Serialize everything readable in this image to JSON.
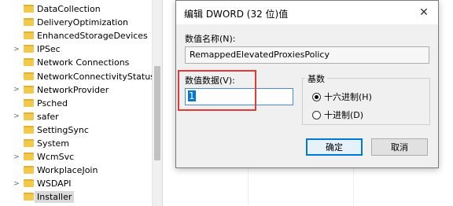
{
  "tree": {
    "items": [
      {
        "label": "DataCollection",
        "expander": ""
      },
      {
        "label": "DeliveryOptimization",
        "expander": ""
      },
      {
        "label": "EnhancedStorageDevices",
        "expander": ""
      },
      {
        "label": "IPSec",
        "expander": ">"
      },
      {
        "label": "Network Connections",
        "expander": ""
      },
      {
        "label": "NetworkConnectivityStatusInc",
        "expander": ""
      },
      {
        "label": "NetworkProvider",
        "expander": ">"
      },
      {
        "label": "Psched",
        "expander": ""
      },
      {
        "label": "safer",
        "expander": ">"
      },
      {
        "label": "SettingSync",
        "expander": ""
      },
      {
        "label": "System",
        "expander": ""
      },
      {
        "label": "WcmSvc",
        "expander": ">"
      },
      {
        "label": "WorkplaceJoin",
        "expander": ""
      },
      {
        "label": "WSDAPI",
        "expander": ">"
      },
      {
        "label": "Installer",
        "expander": "",
        "selected": true
      }
    ]
  },
  "dialog": {
    "title": "编辑 DWORD (32 位)值",
    "close_glyph": "✕",
    "value_name_label": "数值名称(N):",
    "value_name": "RemappedElevatedProxiesPolicy",
    "value_data_label": "数值数据(V):",
    "value_data": "1",
    "base": {
      "title": "基数",
      "hex_label": "十六进制(H)",
      "dec_label": "十进制(D)",
      "selected": "hex"
    },
    "ok_label": "确定",
    "cancel_label": "取消"
  },
  "colors": {
    "highlight": "#e53935",
    "accent": "#0078d7",
    "folder": "#f2c94c"
  }
}
